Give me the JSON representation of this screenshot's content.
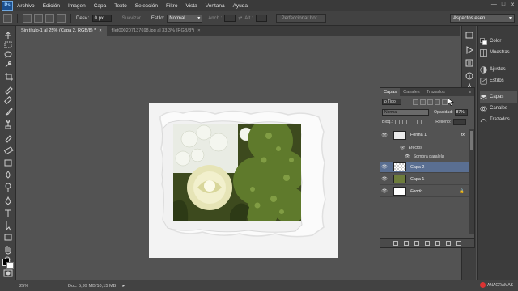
{
  "app": {
    "logo": "Ps"
  },
  "menu": [
    "Archivo",
    "Edición",
    "Imagen",
    "Capa",
    "Texto",
    "Selección",
    "Filtro",
    "Vista",
    "Ventana",
    "Ayuda"
  ],
  "window_controls": {
    "minimize": "—",
    "maximize": "□",
    "close": "✕"
  },
  "options": {
    "feather_label": "Desv.:",
    "feather_value": "0 px",
    "antialias_label": "Suavizar",
    "style_label": "Estilo:",
    "style_value": "Normal",
    "width_label": "Anch.:",
    "height_label": "Alt.:",
    "refine_label": "Perfeccionar bor...",
    "workspace": "Aspectos esen."
  },
  "tabs": [
    {
      "label": "Sin título-1 al 25% (Capa 2, RGB/8) *",
      "close": "×"
    },
    {
      "label": "filet000207137698.jpg al 33.3% (RGB/8*)",
      "close": "×"
    }
  ],
  "right_dock": {
    "group1": [
      "Color",
      "Muestras",
      "Ajustes",
      "Estilos"
    ],
    "group2": [
      "Capas",
      "Canales",
      "Trazados"
    ]
  },
  "layers_panel": {
    "tabs": [
      "Capas",
      "Canales",
      "Trazados"
    ],
    "filter_label": "ρ Tipo",
    "blend_mode": "Normal",
    "opacity_label": "Opacidad:",
    "opacity_value": "87%",
    "lock_label": "Bloq.:",
    "fill_label": "Relleno:",
    "layers": [
      {
        "name": "Forma 1",
        "fx": "fx",
        "selected": false
      },
      {
        "name": "Capa 2",
        "selected": true
      },
      {
        "name": "Capa 1",
        "selected": false
      },
      {
        "name": "Fondo",
        "selected": false
      }
    ],
    "effects_label": "Efectos",
    "drop_shadow_label": "Sombra paralela"
  },
  "status": {
    "zoom": "25%",
    "doc": "Doc: 5,99 MB/10,15 MB"
  },
  "brand": "ANAGRAMAS",
  "colors": {
    "accent": "#5a6f92",
    "brand_dot": "#dd3333",
    "ps_logo": "#1b4f8e"
  }
}
